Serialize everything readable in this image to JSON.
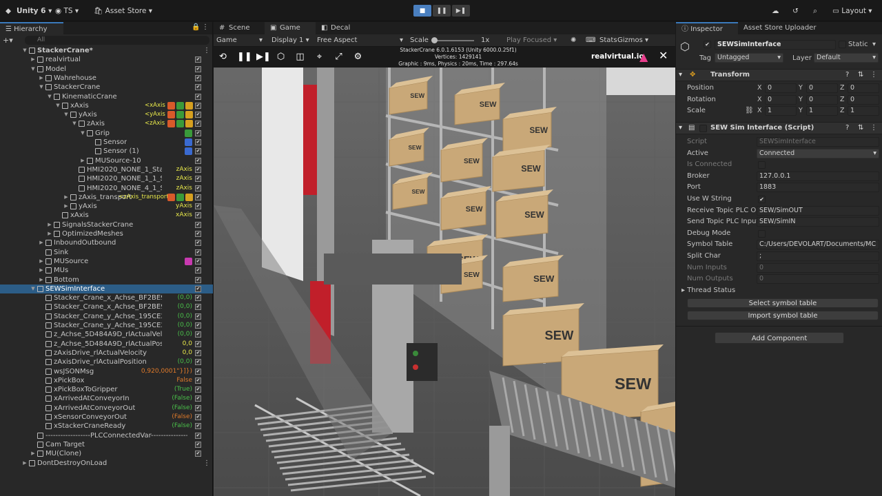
{
  "topbar": {
    "app": "Unity 6",
    "account": "TS",
    "store": "Asset Store",
    "layout": "Layout"
  },
  "hierarchy": {
    "title": "Hierarchy",
    "search_placeholder": "All",
    "rows": [
      {
        "name": "StackerCrane*",
        "depth": 0,
        "arrow": "down",
        "bold": true
      },
      {
        "name": "realvirtual",
        "depth": 1,
        "arrow": "right"
      },
      {
        "name": "Model",
        "depth": 1,
        "arrow": "down"
      },
      {
        "name": "Wahrehouse",
        "depth": 2,
        "arrow": "right"
      },
      {
        "name": "StackerCrane",
        "depth": 2,
        "arrow": "down"
      },
      {
        "name": "KinematicCrane",
        "depth": 3,
        "arrow": "down"
      },
      {
        "name": "xAxis",
        "depth": 4,
        "arrow": "down",
        "tag": "<xAxis"
      },
      {
        "name": "yAxis",
        "depth": 5,
        "arrow": "down",
        "tag": "<yAxis"
      },
      {
        "name": "zAxis",
        "depth": 6,
        "arrow": "down",
        "tag": "<zAxis"
      },
      {
        "name": "Grip",
        "depth": 7,
        "arrow": "down"
      },
      {
        "name": "Sensor",
        "depth": 8,
        "arrow": ""
      },
      {
        "name": "Sensor (1)",
        "depth": 8,
        "arrow": ""
      },
      {
        "name": "MUSource-10",
        "depth": 7,
        "arrow": "right"
      },
      {
        "name": "HMI2020_NONE_1_Standard",
        "depth": 6,
        "arrow": "",
        "val": "zAxis"
      },
      {
        "name": "HMI2020_NONE_1_1_Standard",
        "depth": 6,
        "arrow": "",
        "val": "zAxis"
      },
      {
        "name": "HMI2020_NONE_4_1_Standard",
        "depth": 6,
        "arrow": "",
        "val": "zAxis"
      },
      {
        "name": "zAxis_transport",
        "depth": 5,
        "arrow": "right",
        "tag": "<zAxis_transport"
      },
      {
        "name": "yAxis",
        "depth": 5,
        "arrow": "right",
        "val": "yAxis"
      },
      {
        "name": "xAxis",
        "depth": 4,
        "arrow": "",
        "val": "xAxis"
      },
      {
        "name": "SignalsStackerCrane",
        "depth": 3,
        "arrow": "right"
      },
      {
        "name": "OptimizedMeshes",
        "depth": 3,
        "arrow": "right"
      },
      {
        "name": "InboundOutbound",
        "depth": 2,
        "arrow": "right"
      },
      {
        "name": "Sink",
        "depth": 2,
        "arrow": ""
      },
      {
        "name": "MUSource",
        "depth": 2,
        "arrow": "right"
      },
      {
        "name": "MUs",
        "depth": 2,
        "arrow": "right"
      },
      {
        "name": "Bottom",
        "depth": 2,
        "arrow": "right"
      },
      {
        "name": "SEWSimInterface",
        "depth": 1,
        "arrow": "down",
        "selected": true
      },
      {
        "name": "Stacker_Crane_x_Achse_BF2BE907_rlActualVelocity",
        "depth": 2,
        "arrow": "",
        "val": "(0,0)"
      },
      {
        "name": "Stacker_Crane_x_Achse_BF2BE907_rlActualPosition",
        "depth": 2,
        "arrow": "",
        "val": "(0,0)"
      },
      {
        "name": "Stacker_Crane_y_Achse_195CE2B3_rlActualVelocity",
        "depth": 2,
        "arrow": "",
        "val": "(0,0)"
      },
      {
        "name": "Stacker_Crane_y_Achse_195CE2B3_rlActualPosition",
        "depth": 2,
        "arrow": "",
        "val": "(0,0)"
      },
      {
        "name": "z_Achse_5D484A9D_rlActualVelocity",
        "depth": 2,
        "arrow": "",
        "val": "(0,0)"
      },
      {
        "name": "z_Achse_5D484A9D_rlActualPosition",
        "depth": 2,
        "arrow": "",
        "val": "0,0"
      },
      {
        "name": "zAxisDrive_rlActualVelocity",
        "depth": 2,
        "arrow": "",
        "val": "0,0"
      },
      {
        "name": "zAxisDrive_rlActualPosition",
        "depth": 2,
        "arrow": "",
        "val": "(0,0)"
      },
      {
        "name": "wsJSONMsg",
        "depth": 2,
        "arrow": "",
        "val": "0,920,0001\"}]})",
        "valcolor": "#e07a2a"
      },
      {
        "name": "xPickBox",
        "depth": 2,
        "arrow": "",
        "val": "False",
        "valcolor": "#e07a2a"
      },
      {
        "name": "xPickBoxToGripper",
        "depth": 2,
        "arrow": "",
        "val": "(True)"
      },
      {
        "name": "xArrivedAtConveyorIn",
        "depth": 2,
        "arrow": "",
        "val": "(False)"
      },
      {
        "name": "xArrivedAtConveyorOut",
        "depth": 2,
        "arrow": "",
        "val": "(False)"
      },
      {
        "name": "xSensorConveyorOut",
        "depth": 2,
        "arrow": "",
        "val": "(False)",
        "valcolor": "#e07a2a"
      },
      {
        "name": "xStackerCraneReady",
        "depth": 2,
        "arrow": "",
        "val": "(False)"
      },
      {
        "name": "------------------PLCConnectedVar----------------",
        "depth": 1,
        "arrow": ""
      },
      {
        "name": "Cam Target",
        "depth": 1,
        "arrow": ""
      },
      {
        "name": "MU(Clone)",
        "depth": 1,
        "arrow": "right"
      },
      {
        "name": "DontDestroyOnLoad",
        "depth": 0,
        "arrow": "right"
      }
    ]
  },
  "game": {
    "tabs": [
      "Scene",
      "Game",
      "Decal"
    ],
    "toolbar": {
      "mode": "Game",
      "display": "Display 1",
      "aspect": "Free Aspect",
      "scale_label": "Scale",
      "scale_value": "1x",
      "play_focused": "Play Focused",
      "stats": "Stats",
      "gizmos": "Gizmos"
    },
    "stats_lines": [
      "StackerCrane 6.0.1.6153 (Unity 6000.0.25f1)",
      "Vertices: 1429141",
      "Graphic : 9ms, Physics : 20ms, Time : 297.64s"
    ],
    "brand": "realvirtual.io",
    "box_label": "SEW"
  },
  "inspector": {
    "tabs": [
      "Inspector",
      "Asset Store Uploader"
    ],
    "object_name": "SEWSimInterface",
    "static_label": "Static",
    "tag_label": "Tag",
    "tag_value": "Untagged",
    "layer_label": "Layer",
    "layer_value": "Default",
    "transform": {
      "title": "Transform",
      "rows": [
        {
          "label": "Position",
          "x": "0",
          "y": "0",
          "z": "0"
        },
        {
          "label": "Rotation",
          "x": "0",
          "y": "0",
          "z": "0"
        },
        {
          "label": "Scale",
          "x": "1",
          "y": "1",
          "z": "1"
        }
      ]
    },
    "script": {
      "title": "SEW Sim Interface (Script)",
      "fields": [
        {
          "label": "Script",
          "value": "SEWSimInterface",
          "dim": true
        },
        {
          "label": "Active",
          "value": "Connected",
          "dropdown": true
        },
        {
          "label": "Is Connected",
          "value": "",
          "checkbox": true,
          "dim": true
        },
        {
          "label": "Broker",
          "value": "127.0.0.1"
        },
        {
          "label": "Port",
          "value": "1883"
        },
        {
          "label": "Use W String",
          "value": "✔",
          "checkbox": true
        },
        {
          "label": "Receive Topic PLC O",
          "value": "SEW/SimOUT"
        },
        {
          "label": "Send Topic PLC Input",
          "value": "SEW/SimIN"
        },
        {
          "label": "Debug Mode",
          "value": "",
          "checkbox": true
        },
        {
          "label": "Symbol Table",
          "value": "C:/Users/DEVOLART/Documents/MC"
        },
        {
          "label": "Split Char",
          "value": ";"
        },
        {
          "label": "Num Inputs",
          "value": "0",
          "dim": true
        },
        {
          "label": "Num Outputs",
          "value": "0",
          "dim": true
        }
      ],
      "thread_status": "Thread Status",
      "btn_select": "Select symbol table",
      "btn_import": "Import symbol table"
    },
    "add_component": "Add Component"
  }
}
